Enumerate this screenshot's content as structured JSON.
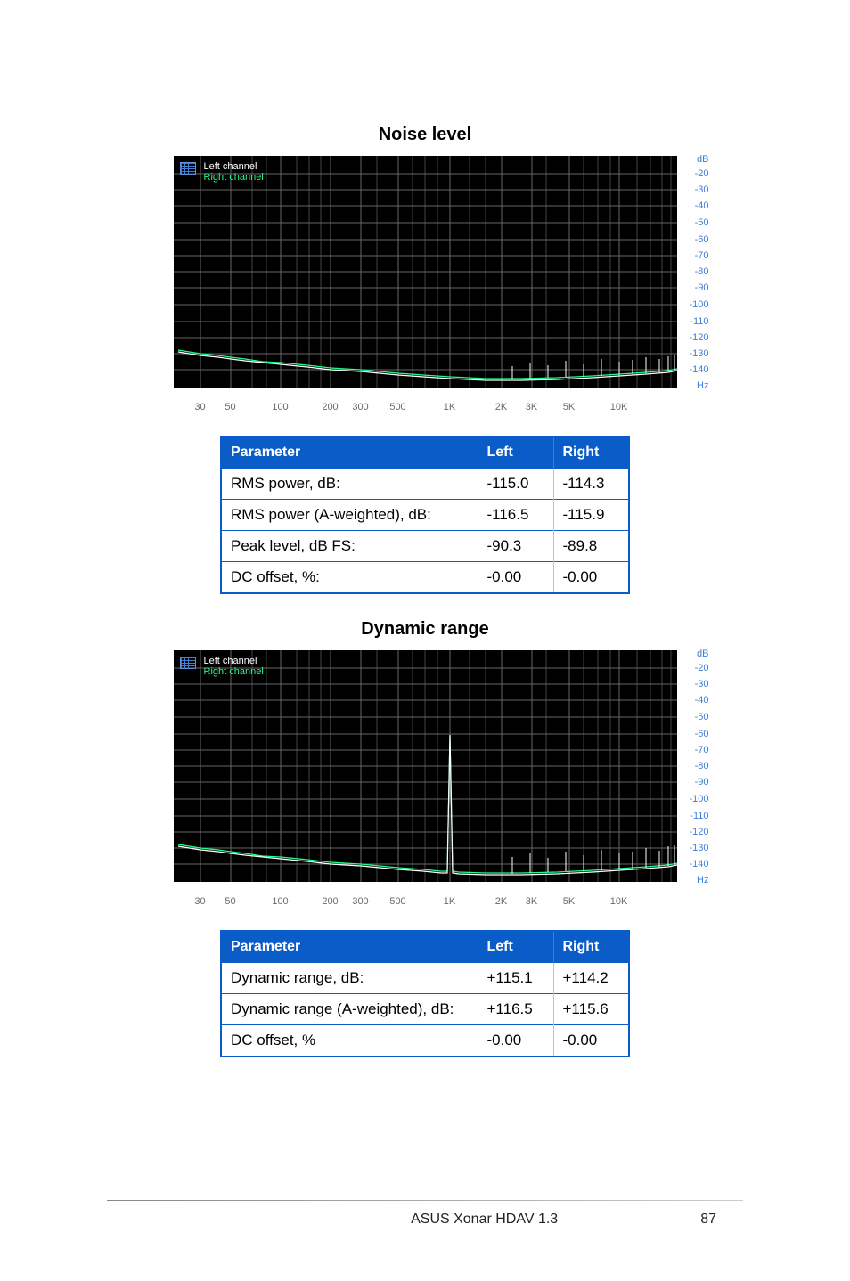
{
  "sections": [
    {
      "title": "Noise level"
    },
    {
      "title": "Dynamic range"
    }
  ],
  "table1": {
    "headers": [
      "Parameter",
      "Left",
      "Right"
    ],
    "rows": [
      {
        "param": "RMS power, dB:",
        "left": "-115.0",
        "right": "-114.3"
      },
      {
        "param": "RMS power (A-weighted), dB:",
        "left": "-116.5",
        "right": "-115.9"
      },
      {
        "param": "Peak level, dB FS:",
        "left": "-90.3",
        "right": "-89.8"
      },
      {
        "param": "DC offset, %:",
        "left": "-0.00",
        "right": "-0.00"
      }
    ]
  },
  "table2": {
    "headers": [
      "Parameter",
      "Left",
      "Right"
    ],
    "rows": [
      {
        "param": "Dynamic range, dB:",
        "left": "+115.1",
        "right": "+114.2"
      },
      {
        "param": "Dynamic range (A-weighted), dB:",
        "left": "+116.5",
        "right": "+115.6"
      },
      {
        "param": "DC offset, %",
        "left": "-0.00",
        "right": "-0.00"
      }
    ]
  },
  "chart_data": [
    {
      "type": "line",
      "title": "Noise level",
      "xlabel": "Hz",
      "ylabel": "dB",
      "x_ticks": [
        30,
        50,
        100,
        200,
        300,
        500,
        "1K",
        "2K",
        "3K",
        "5K",
        "10K"
      ],
      "y_ticks": [
        -20,
        -30,
        -40,
        -50,
        -60,
        -70,
        -80,
        -90,
        -100,
        -110,
        -120,
        -130,
        -140
      ],
      "x_range_hz": [
        20,
        20000
      ],
      "y_range_db": [
        -150,
        -10
      ],
      "legend": [
        "Left channel",
        "Right channel"
      ],
      "series": [
        {
          "name": "Left channel",
          "color": "#ffffff",
          "x_hz": [
            20,
            30,
            40,
            50,
            60,
            80,
            100,
            150,
            200,
            300,
            500,
            700,
            1000,
            1500,
            2000,
            3000,
            5000,
            7000,
            10000,
            15000,
            20000
          ],
          "y_db": [
            -128,
            -130,
            -131,
            -132,
            -133,
            -134,
            -135,
            -137,
            -138,
            -140,
            -142,
            -143,
            -144,
            -145,
            -145,
            -144,
            -143,
            -141,
            -140,
            -138,
            -136
          ]
        },
        {
          "name": "Right channel",
          "color": "#22ff88",
          "x_hz": [
            20,
            30,
            40,
            50,
            60,
            80,
            100,
            150,
            200,
            300,
            500,
            700,
            1000,
            1500,
            2000,
            3000,
            5000,
            7000,
            10000,
            15000,
            20000
          ],
          "y_db": [
            -127,
            -129,
            -130,
            -131,
            -132,
            -133,
            -134,
            -136,
            -138,
            -140,
            -142,
            -143,
            -144,
            -145,
            -145,
            -144,
            -143,
            -141,
            -140,
            -138,
            -136
          ]
        }
      ]
    },
    {
      "type": "line",
      "title": "Dynamic range",
      "xlabel": "Hz",
      "ylabel": "dB",
      "x_ticks": [
        30,
        50,
        100,
        200,
        300,
        500,
        "1K",
        "2K",
        "3K",
        "5K",
        "10K"
      ],
      "y_ticks": [
        -20,
        -30,
        -40,
        -50,
        -60,
        -70,
        -80,
        -90,
        -100,
        -110,
        -120,
        -130,
        -140
      ],
      "x_range_hz": [
        20,
        20000
      ],
      "y_range_db": [
        -150,
        -10
      ],
      "legend": [
        "Left channel",
        "Right channel"
      ],
      "series": [
        {
          "name": "Left channel",
          "color": "#ffffff",
          "x_hz": [
            20,
            30,
            40,
            50,
            60,
            80,
            100,
            150,
            200,
            300,
            500,
            700,
            900,
            1000,
            1100,
            1500,
            2000,
            3000,
            5000,
            7000,
            10000,
            15000,
            20000
          ],
          "y_db": [
            -128,
            -130,
            -131,
            -132,
            -133,
            -134,
            -135,
            -137,
            -138,
            -140,
            -142,
            -143,
            -144,
            -60,
            -144,
            -145,
            -145,
            -144,
            -143,
            -141,
            -140,
            -138,
            -136
          ]
        },
        {
          "name": "Right channel",
          "color": "#22ff88",
          "x_hz": [
            20,
            30,
            40,
            50,
            60,
            80,
            100,
            150,
            200,
            300,
            500,
            700,
            900,
            1000,
            1100,
            1500,
            2000,
            3000,
            5000,
            7000,
            10000,
            15000,
            20000
          ],
          "y_db": [
            -127,
            -129,
            -130,
            -131,
            -132,
            -133,
            -134,
            -136,
            -138,
            -140,
            -142,
            -143,
            -144,
            -60,
            -144,
            -145,
            -145,
            -144,
            -143,
            -141,
            -140,
            -138,
            -136
          ]
        }
      ]
    }
  ],
  "footer": {
    "product": "ASUS Xonar HDAV 1.3",
    "page": "87"
  },
  "axis": {
    "y_unit": "dB",
    "x_unit": "Hz"
  }
}
